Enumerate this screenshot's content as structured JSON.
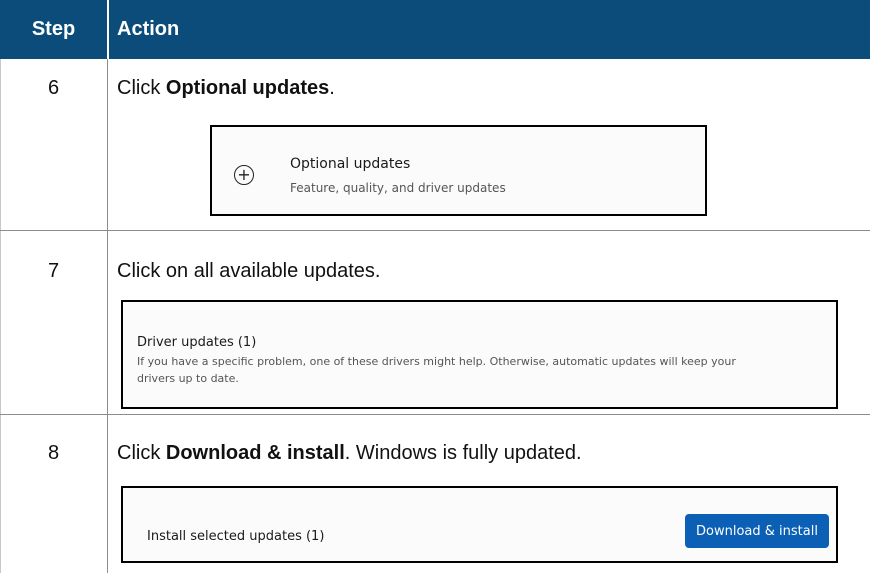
{
  "header": {
    "step": "Step",
    "action": "Action"
  },
  "rows": [
    {
      "step": "6",
      "instruction": {
        "prefix": "Click ",
        "bold": "Optional updates",
        "suffix": "."
      },
      "screenshot": {
        "icon": "plus-circle-icon",
        "title": "Optional updates",
        "subtitle": "Feature, quality, and driver updates"
      }
    },
    {
      "step": "7",
      "instruction": {
        "text": "Click on all available updates."
      },
      "screenshot": {
        "title": "Driver updates (1)",
        "line1": "If you have a specific problem, one of these drivers might help. Otherwise, automatic updates will keep your",
        "line2": "drivers up to date."
      }
    },
    {
      "step": "8",
      "instruction": {
        "prefix": "Click ",
        "bold": "Download & install",
        "suffix": ". Windows is fully updated."
      },
      "screenshot": {
        "label": "Install selected updates (1)",
        "button": "Download & install"
      }
    }
  ],
  "colors": {
    "header_bg": "#0b4c7a",
    "button_bg": "#0b5fb5"
  }
}
